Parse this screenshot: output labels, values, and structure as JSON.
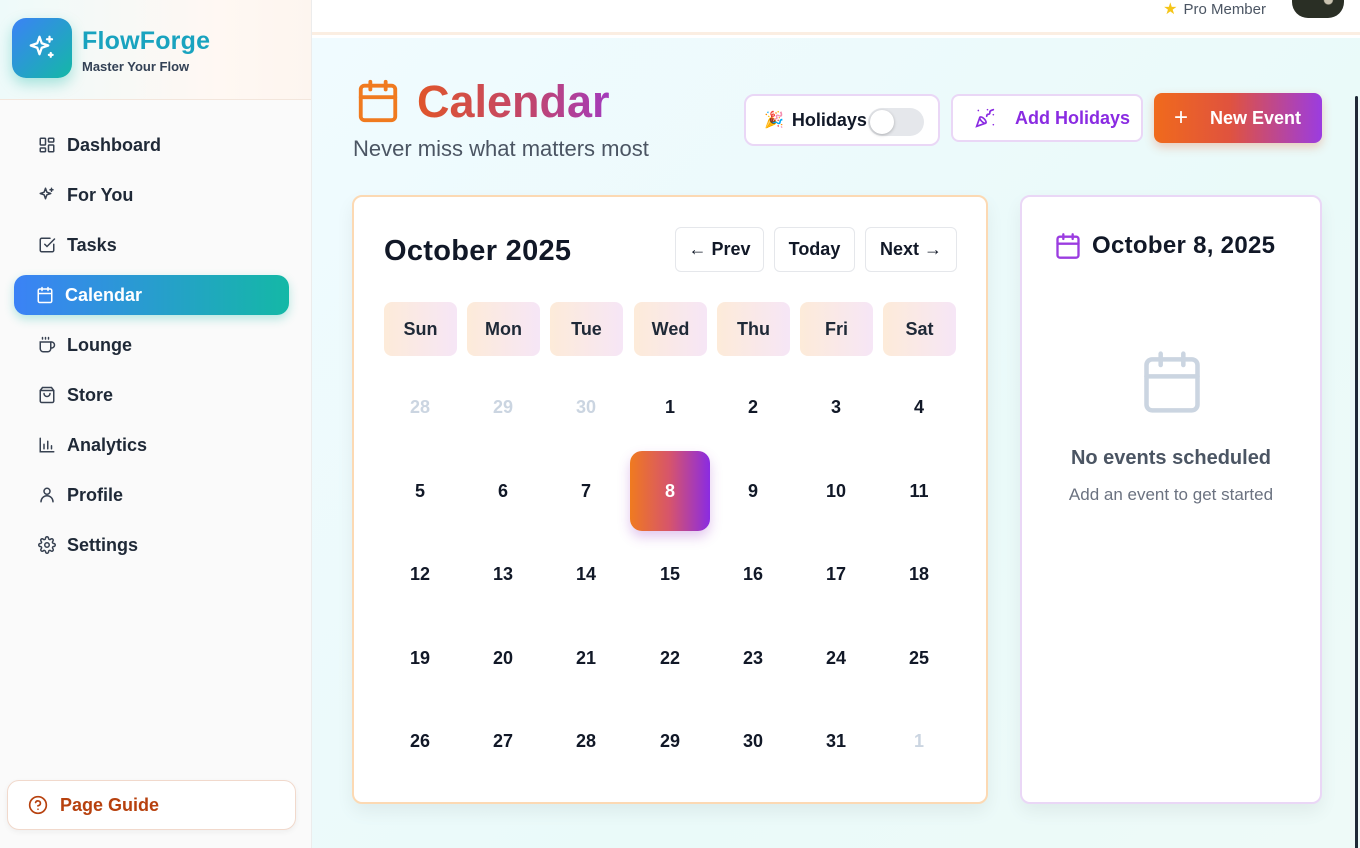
{
  "brand": {
    "name": "FlowForge",
    "tagline": "Master Your Flow",
    "icon": "sparkle-icon"
  },
  "sidebar": {
    "items": [
      {
        "label": "Dashboard",
        "icon": "grid-icon",
        "active": false
      },
      {
        "label": "For You",
        "icon": "sparkle-icon",
        "active": false
      },
      {
        "label": "Tasks",
        "icon": "checkbox-icon",
        "active": false
      },
      {
        "label": "Calendar",
        "icon": "calendar-icon",
        "active": true
      },
      {
        "label": "Lounge",
        "icon": "coffee-icon",
        "active": false
      },
      {
        "label": "Store",
        "icon": "shopping-bag-icon",
        "active": false
      },
      {
        "label": "Analytics",
        "icon": "bar-chart-icon",
        "active": false
      },
      {
        "label": "Profile",
        "icon": "user-icon",
        "active": false
      },
      {
        "label": "Settings",
        "icon": "gear-icon",
        "active": false
      }
    ],
    "guide_label": "Page Guide"
  },
  "topbar": {
    "membership": "Pro Member"
  },
  "header": {
    "title": "Calendar",
    "subtitle": "Never miss what matters most",
    "holidays_label": "Holidays",
    "holidays_enabled": false,
    "add_holidays_label": "Add Holidays",
    "new_event_label": "New Event"
  },
  "calendar": {
    "month_title": "October 2025",
    "prev_label": "← Prev",
    "today_label": "Today",
    "next_label": "Next →",
    "weekdays": [
      "Sun",
      "Mon",
      "Tue",
      "Wed",
      "Thu",
      "Fri",
      "Sat"
    ],
    "weeks": [
      [
        {
          "d": "28",
          "m": true
        },
        {
          "d": "29",
          "m": true
        },
        {
          "d": "30",
          "m": true
        },
        {
          "d": "1"
        },
        {
          "d": "2"
        },
        {
          "d": "3"
        },
        {
          "d": "4"
        }
      ],
      [
        {
          "d": "5"
        },
        {
          "d": "6"
        },
        {
          "d": "7"
        },
        {
          "d": "8",
          "sel": true
        },
        {
          "d": "9"
        },
        {
          "d": "10"
        },
        {
          "d": "11"
        }
      ],
      [
        {
          "d": "12"
        },
        {
          "d": "13"
        },
        {
          "d": "14"
        },
        {
          "d": "15"
        },
        {
          "d": "16"
        },
        {
          "d": "17"
        },
        {
          "d": "18"
        }
      ],
      [
        {
          "d": "19"
        },
        {
          "d": "20"
        },
        {
          "d": "21"
        },
        {
          "d": "22"
        },
        {
          "d": "23"
        },
        {
          "d": "24"
        },
        {
          "d": "25"
        }
      ],
      [
        {
          "d": "26"
        },
        {
          "d": "27"
        },
        {
          "d": "28"
        },
        {
          "d": "29"
        },
        {
          "d": "30"
        },
        {
          "d": "31"
        },
        {
          "d": "1",
          "m": true
        }
      ]
    ]
  },
  "details": {
    "date_title": "October 8, 2025",
    "empty_title": "No events scheduled",
    "empty_subtitle": "Add an event to get started"
  },
  "colors": {
    "accent_teal": "#14b8a6",
    "accent_blue": "#3b82f6",
    "accent_orange": "#f06a1c",
    "accent_purple": "#8a2be2"
  }
}
